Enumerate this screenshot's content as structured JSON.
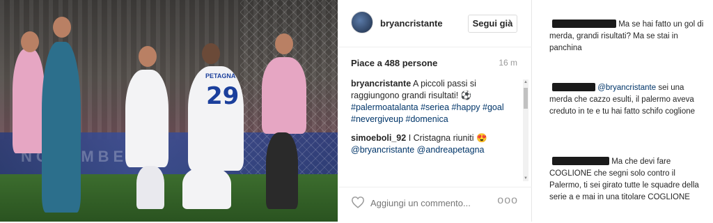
{
  "post": {
    "username": "bryancristante",
    "follow_label": "Segui già",
    "likes": "Piace a 488 persone",
    "time": "16 m",
    "comments": [
      {
        "user": "bryancristante",
        "text": "A piccoli passi si raggiungono grandi risultati! ⚽",
        "tags": "#palermoatalanta #seriea #happy #goal #nevergiveup #domenica"
      },
      {
        "user": "simoeboli_92",
        "text": "I Cristagna riuniti 😍",
        "tags": "@bryancristante @andreapetagna"
      }
    ],
    "comment_placeholder": "Aggiungi un commento...",
    "more_label": "ooo"
  },
  "photo": {
    "jersey_name": "PETAGNA",
    "jersey_number": "29",
    "board_text": "NOVEMBER"
  },
  "side_comments": [
    {
      "text": "Ma se hai fatto un gol di merda, grandi risultati? Ma se stai in panchina"
    },
    {
      "mention": "@bryancristante",
      "text": "sei una merda che cazzo esulti, il palermo aveva creduto in te e tu hai fatto schifo coglione"
    },
    {
      "text": "Ma che devi fare COGLIONE che segni solo contro il Palermo, ti sei girato tutte le squadre della serie a e mai in una titolare COGLIONE"
    }
  ],
  "icons": {
    "heart": "heart-outline-icon",
    "more": "more-options-icon"
  }
}
